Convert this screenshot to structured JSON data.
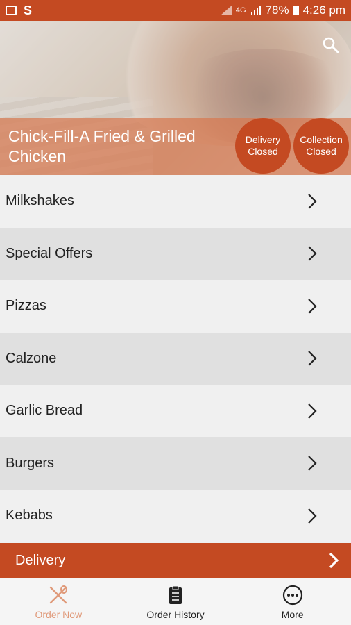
{
  "status_bar": {
    "network": "4G",
    "battery": "78%",
    "time": "4:26 pm"
  },
  "header": {
    "restaurant_name": "Chick-Fill-A Fried & Grilled Chicken",
    "delivery_status": {
      "line1": "Delivery",
      "line2": "Closed"
    },
    "collection_status": {
      "line1": "Collection",
      "line2": "Closed"
    }
  },
  "categories": [
    {
      "label": "Milkshakes"
    },
    {
      "label": "Special Offers"
    },
    {
      "label": "Pizzas"
    },
    {
      "label": "Calzone"
    },
    {
      "label": "Garlic Bread"
    },
    {
      "label": "Burgers"
    },
    {
      "label": "Kebabs"
    }
  ],
  "delivery_bar": {
    "label": "Delivery"
  },
  "bottom_nav": {
    "order_now": "Order Now",
    "order_history": "Order History",
    "more": "More"
  },
  "colors": {
    "brand": "#c44a22",
    "active_nav": "#e09a7a"
  },
  "icons": {
    "search": "search-icon",
    "chevron": "chevron-right-icon",
    "order_now": "fork-spoon-icon",
    "order_history": "clipboard-icon",
    "more": "more-dots-icon"
  }
}
